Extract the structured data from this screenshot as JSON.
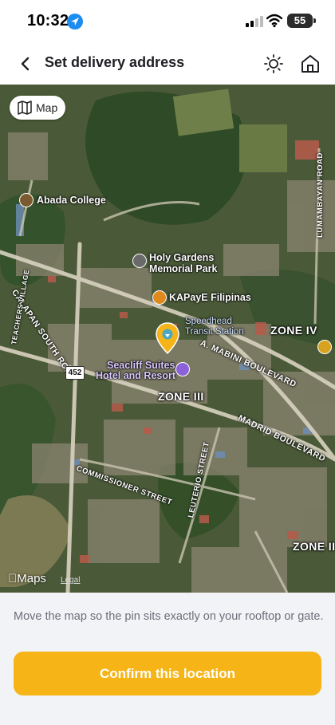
{
  "status_bar": {
    "time": "10:32",
    "battery": "55"
  },
  "nav": {
    "title": "Set delivery address",
    "back_icon": "chevron-left-icon",
    "theme_icon": "sun-icon",
    "home_icon": "home-icon"
  },
  "map": {
    "toggle_label": "Map",
    "toggle_icon": "map-icon",
    "labels": {
      "abada": "Abada College",
      "holy_gardens_1": "Holy Gardens",
      "holy_gardens_2": "Memorial Park",
      "kapaye": "KAPayE Filipinas",
      "speedhead_1": "Speedhead",
      "speedhead_2": "Transit Station",
      "seacliff_1": "Seacliff Suites",
      "seacliff_2": "Hotel and Resort",
      "zone_iv": "ZONE IV",
      "zone_iii": "ZONE III",
      "zone_ii": "ZONE II",
      "calapan_south_road": "CALAPAN SOUTH ROAD",
      "teachers_village": "TEACHERS VILLAGE",
      "a_mabini": "A. MABINI BOULEVARD",
      "madrid": "MADRID BOULEVARD",
      "commissioner": "COMMISSIONER STREET",
      "leuterio": "LEUTERIO STREET",
      "lumambayan": "LUMAMBAYAN ROAD",
      "route_452": "452"
    },
    "attribution": "Maps",
    "legal": "Legal",
    "pin_color": "#f6b417"
  },
  "footer": {
    "hint": "Move the map so the pin sits exactly on your rooftop or gate.",
    "confirm_label": "Confirm this location",
    "accent": "#f6b417"
  }
}
